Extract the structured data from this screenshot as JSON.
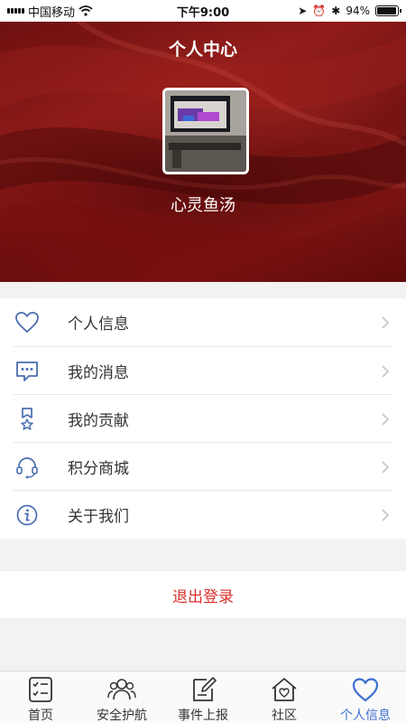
{
  "status_bar": {
    "carrier": "中国移动",
    "time": "下午9:00",
    "battery": "94%",
    "battery_level": 0.94
  },
  "header": {
    "title": "个人中心",
    "nickname": "心灵鱼汤"
  },
  "menu": {
    "items": [
      {
        "label": "个人信息",
        "icon": "heart-icon"
      },
      {
        "label": "我的消息",
        "icon": "message-icon"
      },
      {
        "label": "我的贡献",
        "icon": "bookmark-star-icon"
      },
      {
        "label": "积分商城",
        "icon": "headset-icon"
      },
      {
        "label": "关于我们",
        "icon": "info-icon"
      }
    ]
  },
  "logout_label": "退出登录",
  "tabbar": {
    "tabs": [
      {
        "label": "首页",
        "icon": "checklist-icon"
      },
      {
        "label": "安全护航",
        "icon": "people-icon"
      },
      {
        "label": "事件上报",
        "icon": "edit-icon"
      },
      {
        "label": "社区",
        "icon": "house-heart-icon"
      },
      {
        "label": "个人信息",
        "icon": "heart-icon"
      }
    ],
    "active": "个人信息"
  },
  "colors": {
    "accent": "#3d6fd1",
    "logout": "#d9302c",
    "header_bg": "#7a1413"
  }
}
